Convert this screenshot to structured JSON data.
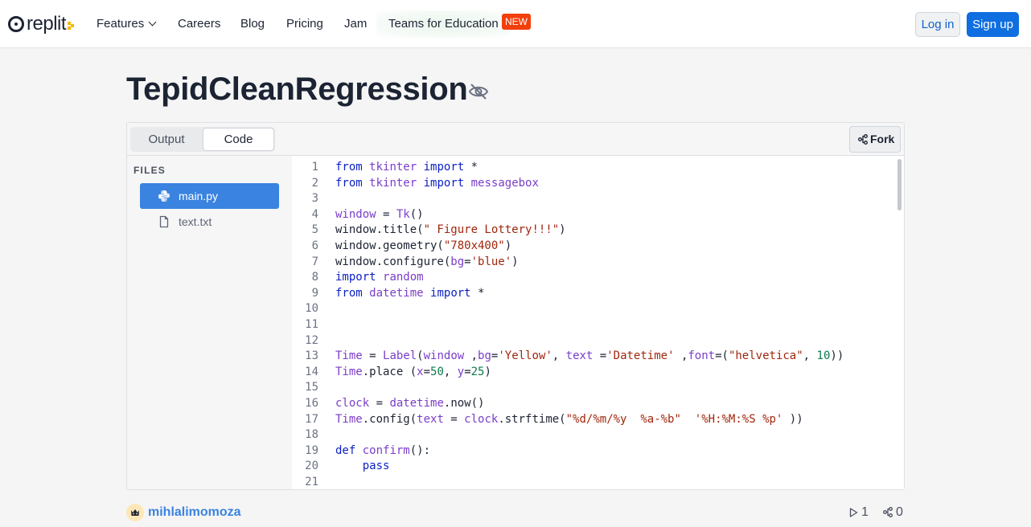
{
  "brand": {
    "name": "replit"
  },
  "nav": {
    "features": "Features",
    "careers": "Careers",
    "blog": "Blog",
    "pricing": "Pricing",
    "jam": "Jam",
    "teams": "Teams for Education",
    "new_badge": "NEW",
    "login": "Log in",
    "signup": "Sign up"
  },
  "repl": {
    "title": "TepidCleanRegression",
    "visibility_icon": "eye-off-icon"
  },
  "tabs": {
    "output": "Output",
    "code": "Code",
    "active": "Code"
  },
  "fork_label": "Fork",
  "files": {
    "label": "FILES",
    "items": [
      {
        "name": "main.py",
        "icon": "python-icon",
        "active": true
      },
      {
        "name": "text.txt",
        "icon": "file-icon",
        "active": false
      }
    ]
  },
  "code": {
    "lines": [
      {
        "n": "1",
        "text": "from tkinter import *"
      },
      {
        "n": "2",
        "text": "from tkinter import messagebox"
      },
      {
        "n": "3",
        "text": ""
      },
      {
        "n": "4",
        "text": "window = Tk()"
      },
      {
        "n": "5",
        "text": "window.title(\" Figure Lottery!!!\")"
      },
      {
        "n": "6",
        "text": "window.geometry(\"780x400\")"
      },
      {
        "n": "7",
        "text": "window.configure(bg='blue')"
      },
      {
        "n": "8",
        "text": "import random"
      },
      {
        "n": "9",
        "text": "from datetime import *"
      },
      {
        "n": "10",
        "text": ""
      },
      {
        "n": "11",
        "text": ""
      },
      {
        "n": "12",
        "text": ""
      },
      {
        "n": "13",
        "text": "Time = Label(window ,bg='Yellow', text ='Datetime' ,font=(\"helvetica\", 10))"
      },
      {
        "n": "14",
        "text": "Time.place (x=50, y=25)"
      },
      {
        "n": "15",
        "text": ""
      },
      {
        "n": "16",
        "text": "clock = datetime.now()"
      },
      {
        "n": "17",
        "text": "Time.config(text = clock.strftime(\"%d/%m/%y  %a-%b\"  '%H:%M:%S %p' ))"
      },
      {
        "n": "18",
        "text": ""
      },
      {
        "n": "19",
        "text": "def confirm():"
      },
      {
        "n": "20",
        "text": "    pass"
      },
      {
        "n": "21",
        "text": ""
      }
    ]
  },
  "footer": {
    "author": "mihlalimomoza",
    "runs": "1",
    "forks": "0"
  },
  "colors": {
    "accent": "#0f6ee0",
    "new_badge": "#f23f0c",
    "active_file": "#3a83e0",
    "keyword": "#0b1fc2",
    "name": "#7a3ec9",
    "string": "#a1260d",
    "number": "#0b7b4c"
  }
}
